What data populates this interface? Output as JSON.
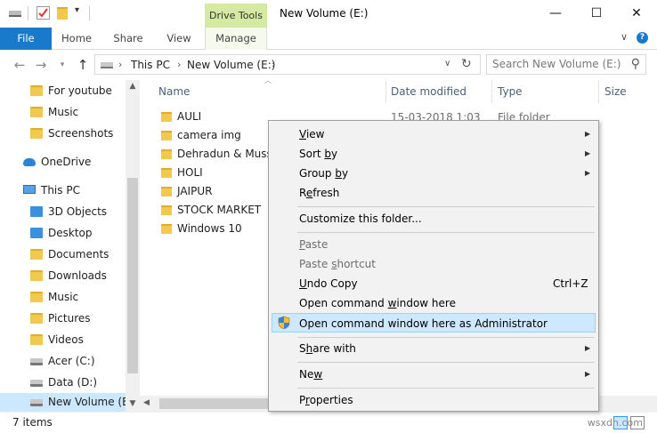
{
  "window": {
    "title": "New Volume (E:)",
    "context_tab": "Drive Tools",
    "minimize": "—",
    "maximize": "☐",
    "close": "✕"
  },
  "ribbon": {
    "tabs": [
      "File",
      "Home",
      "Share",
      "View",
      "Manage"
    ],
    "collapse": "∨",
    "help": "?"
  },
  "address": {
    "crumbs": [
      "This PC",
      "New Volume (E:)"
    ],
    "search_placeholder": "Search New Volume (E:)"
  },
  "sidebar": {
    "items": [
      {
        "label": "For youtube",
        "icon": "folder-icon"
      },
      {
        "label": "Music",
        "icon": "folder-icon"
      },
      {
        "label": "Screenshots",
        "icon": "folder-icon"
      },
      {
        "label": "OneDrive",
        "icon": "cloud-icon"
      },
      {
        "label": "This PC",
        "icon": "computer-icon"
      },
      {
        "label": "3D Objects",
        "icon": "3d-objects-icon"
      },
      {
        "label": "Desktop",
        "icon": "desktop-icon"
      },
      {
        "label": "Documents",
        "icon": "documents-icon"
      },
      {
        "label": "Downloads",
        "icon": "downloads-icon"
      },
      {
        "label": "Music",
        "icon": "music-icon"
      },
      {
        "label": "Pictures",
        "icon": "pictures-icon"
      },
      {
        "label": "Videos",
        "icon": "videos-icon"
      },
      {
        "label": "Acer (C:)",
        "icon": "drive-icon"
      },
      {
        "label": "Data (D:)",
        "icon": "drive-icon"
      },
      {
        "label": "New Volume (E:)",
        "icon": "drive-icon"
      }
    ]
  },
  "columns": [
    "Name",
    "Date modified",
    "Type",
    "Size"
  ],
  "files": [
    {
      "name": "AULI",
      "date": "15-03-2018 1:03",
      "type": "File folder"
    },
    {
      "name": "camera img"
    },
    {
      "name": "Dehradun & Mussoorie"
    },
    {
      "name": "HOLI"
    },
    {
      "name": "JAIPUR"
    },
    {
      "name": "STOCK MARKET"
    },
    {
      "name": "Windows 10"
    }
  ],
  "context_menu": {
    "view": {
      "pre": "",
      "key": "V",
      "post": "iew"
    },
    "sort_by": {
      "pre": "Sort ",
      "key": "b",
      "post": "y"
    },
    "group_by": {
      "pre": "Group ",
      "key": "b",
      "post": "y"
    },
    "refresh": {
      "pre": "R",
      "key": "e",
      "post": "fresh"
    },
    "customize": "Customize this folder...",
    "paste": {
      "pre": "",
      "key": "P",
      "post": "aste"
    },
    "paste_shortcut": {
      "pre": "Paste ",
      "key": "s",
      "post": "hortcut"
    },
    "undo_copy": {
      "pre": "",
      "key": "U",
      "post": "ndo Copy"
    },
    "undo_shortcut": "Ctrl+Z",
    "open_cmd": {
      "pre": "Open command ",
      "key": "w",
      "post": "indow here"
    },
    "open_cmd_admin": "Open command window here as Administrator",
    "share_with": {
      "pre": "S",
      "key": "h",
      "post": "are with"
    },
    "new": {
      "pre": "Ne",
      "key": "w",
      "post": ""
    },
    "properties": {
      "pre": "P",
      "key": "r",
      "post": "operties"
    }
  },
  "status": {
    "count": "7 items",
    "watermark": "wsxdn.com"
  }
}
